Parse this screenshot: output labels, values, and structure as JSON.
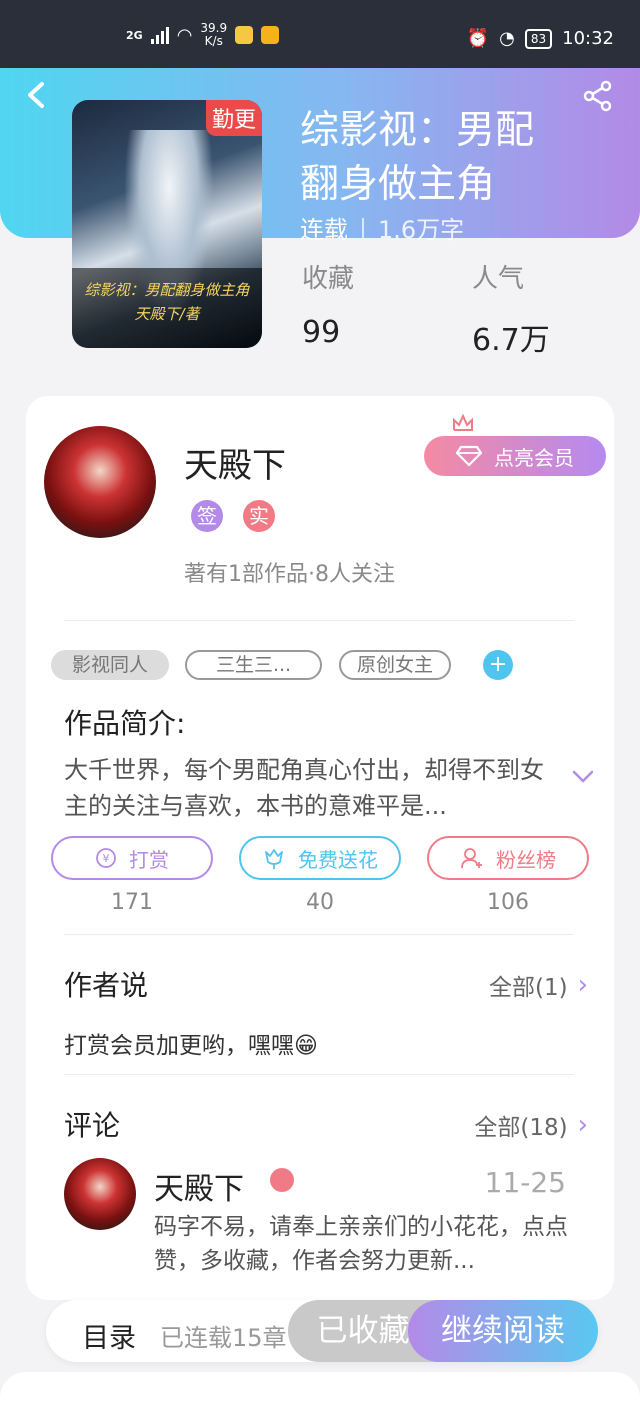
{
  "status_bar": {
    "network": "2G",
    "speed": "39.9",
    "speed_unit": "K/s",
    "battery": "83",
    "time": "10:32"
  },
  "book": {
    "cover_badge": "勤更",
    "cover_caption_title": "综影视：男配翻身做主角",
    "cover_caption_author": "天殿下/著",
    "title_line1": "综影视：男配",
    "title_line2": "翻身做主角",
    "status": "连载",
    "word_count": "1.6万字"
  },
  "stats": {
    "collect_label": "收藏",
    "collect_value": "99",
    "popularity_label": "人气",
    "popularity_value": "6.7万"
  },
  "author": {
    "name": "天殿下",
    "badge_sign": "签",
    "badge_real": "实",
    "meta": "著有1部作品·8人关注",
    "vip_button": "点亮会员"
  },
  "tags": [
    "影视同人",
    "三生三...",
    "原创女主"
  ],
  "tag_add": "+",
  "intro": {
    "title": "作品简介:",
    "text": "大千世界，每个男配角真心付出，却得不到女主的关注与喜欢，本书的意难平是..."
  },
  "actions": [
    {
      "label": "打赏",
      "count": "171",
      "icon": "yen-icon",
      "color": "#b48ae8"
    },
    {
      "label": "免费送花",
      "count": "40",
      "icon": "flower-icon",
      "color": "#4fc5ee"
    },
    {
      "label": "粉丝榜",
      "count": "106",
      "icon": "fans-icon",
      "color": "#f07b86"
    }
  ],
  "author_say": {
    "title": "作者说",
    "more": "全部(1)",
    "text": "打赏会员加更哟，嘿嘿😁"
  },
  "comments": {
    "title": "评论",
    "more": "全部(18)",
    "items": [
      {
        "user": "天殿下",
        "date": "11-25",
        "text": "码字不易，请奉上亲亲们的小花花，点点赞，多收藏，作者会努力更新..."
      }
    ]
  },
  "bottom": {
    "toc": "目录",
    "toc_status": "已连载15章",
    "collected": "已收藏",
    "continue": "继续阅读"
  }
}
